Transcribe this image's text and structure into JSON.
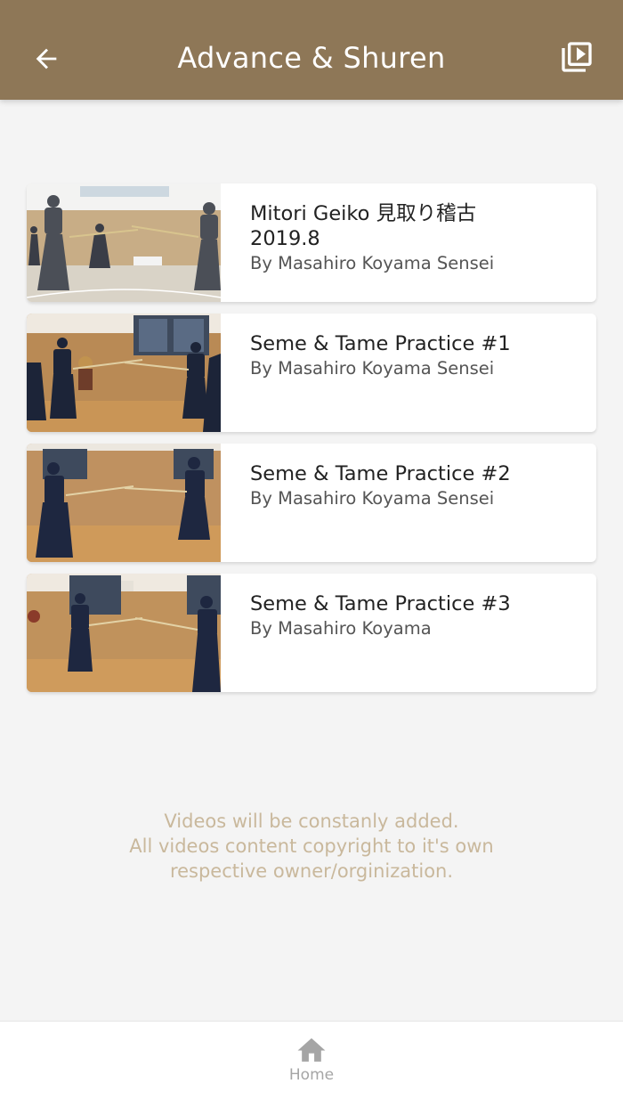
{
  "header": {
    "title": "Advance & Shuren",
    "back_icon": "arrow-left-icon",
    "playlist_icon": "video-library-icon",
    "background": "#8e7757"
  },
  "videos": [
    {
      "title_line1": "Mitori Geiko 見取り稽古",
      "title_line2": "2019.8",
      "subtitle": "By Masahiro Koyama Sensei"
    },
    {
      "title_line1": "Seme & Tame Practice #1",
      "title_line2": "",
      "subtitle": "By Masahiro Koyama Sensei"
    },
    {
      "title_line1": "Seme & Tame Practice #2",
      "title_line2": "",
      "subtitle": "By Masahiro Koyama Sensei"
    },
    {
      "title_line1": "Seme & Tame Practice #3",
      "title_line2": "",
      "subtitle": "By Masahiro Koyama"
    }
  ],
  "footer_note": {
    "line1": "Videos will be constanly added.",
    "line2": "All videos content copyright to it's own",
    "line3": "respective owner/orginization."
  },
  "bottom_nav": {
    "home_label": "Home",
    "home_icon": "home-icon"
  }
}
